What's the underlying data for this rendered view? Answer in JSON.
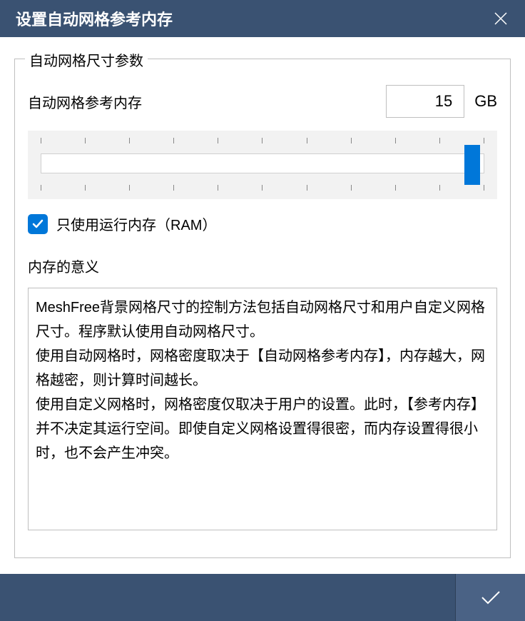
{
  "dialog": {
    "title": "设置自动网格参考内存"
  },
  "fieldset": {
    "legend": "自动网格尺寸参数",
    "param_label": "自动网格参考内存",
    "param_value": "15",
    "param_unit": "GB",
    "slider": {
      "min": 0,
      "max": 16,
      "value": 15,
      "tick_count": 11
    },
    "checkbox": {
      "checked": true,
      "label": "只使用运行内存（RAM）"
    },
    "section_title": "内存的意义",
    "description": "MeshFree背景网格尺寸的控制方法包括自动网格尺寸和用户自定义网格尺寸。程序默认使用自动网格尺寸。\n使用自动网格时，网格密度取决于【自动网格参考内存】，内存越大，网格越密，则计算时间越长。\n使用自定义网格时，网格密度仅取决于用户的设置。此时，【参考内存】并不决定其运行空间。即使自定义网格设置得很密，而内存设置得很小时，也不会产生冲突。"
  },
  "icons": {
    "close": "close-icon",
    "check": "check-icon",
    "confirm": "confirm-check-icon"
  }
}
